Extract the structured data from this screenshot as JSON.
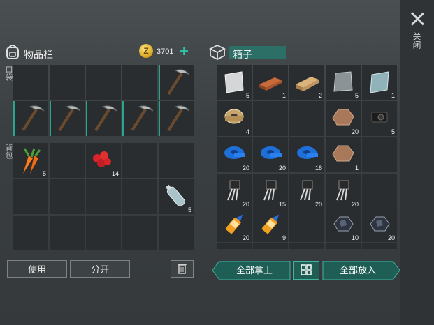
{
  "close": {
    "label": "关闭"
  },
  "inventory": {
    "title": "物品栏",
    "currency": "3701",
    "pocket_label": "口袋",
    "backpack_label": "背包",
    "items": {
      "carrot_count": "5",
      "berries_count": "14",
      "bottle_count": "5"
    }
  },
  "chest": {
    "name": "箱子",
    "items": {
      "metal_sheet_count": "5",
      "copper_bar_count": "1",
      "wood_plank_count": "2",
      "steel_plate_count": "5",
      "glass_count": "1",
      "wire_spool_count": "4",
      "ore1_count": "20",
      "camera_count": "5",
      "tape1_count": "20",
      "tape2_count": "20",
      "tape3_count": "18",
      "ore2_count": "1",
      "transistor1_count": "20",
      "transistor2_count": "15",
      "transistor3_count": "20",
      "transistor4_count": "20",
      "glue1_count": "20",
      "glue2_count": "9",
      "coal1_count": "10",
      "coal2_count": "20"
    }
  },
  "buttons": {
    "use": "使用",
    "split": "分开",
    "take_all": "全部拿上",
    "put_all": "全部放入"
  },
  "colors": {
    "accent": "#2aa58f",
    "button_teal": "#1f5e55"
  }
}
